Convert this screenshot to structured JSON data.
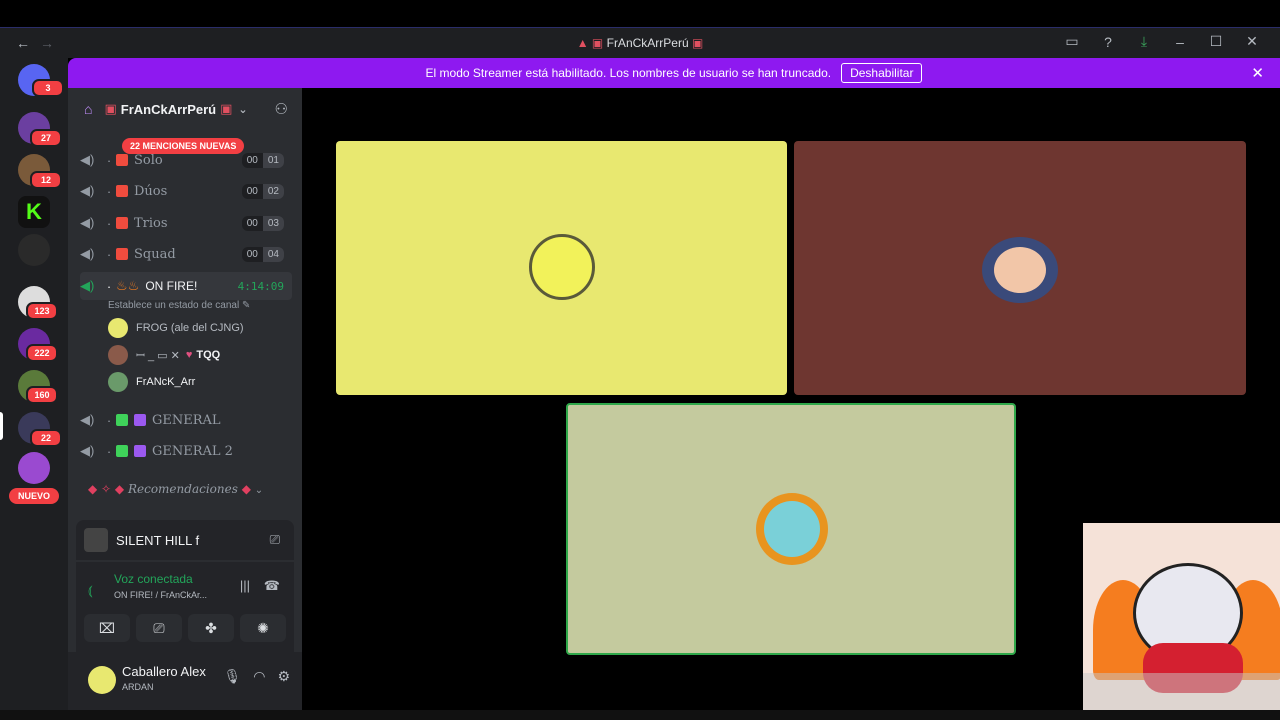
{
  "window": {
    "title": "FrAnCkArrPerú",
    "controls": [
      "inbox-icon",
      "help-icon",
      "download-icon",
      "minimize-icon",
      "maximize-icon",
      "close-icon"
    ]
  },
  "rail": {
    "servers": [
      {
        "badge": "3"
      },
      {
        "badge": "27"
      },
      {
        "badge": "12"
      },
      {
        "badge": ""
      },
      {
        "badge": ""
      },
      {
        "badge": "123"
      },
      {
        "badge": "222"
      },
      {
        "badge": "160"
      },
      {
        "badge": "22"
      },
      {
        "badge": ""
      }
    ],
    "nuevo": "NUEVO"
  },
  "banner": {
    "message": "El modo Streamer está habilitado. Los nombres de usuario se han truncado.",
    "button": "Deshabilitar"
  },
  "sidebar": {
    "server_name": "FrAnCkArrPerú",
    "mentions": "22 MENCIONES NUEVAS",
    "channels": [
      {
        "name": "Solo",
        "count_a": "00",
        "count_b": "01"
      },
      {
        "name": "Dúos",
        "count_a": "00",
        "count_b": "02"
      },
      {
        "name": "Trios",
        "count_a": "00",
        "count_b": "03"
      },
      {
        "name": "Squad",
        "count_a": "00",
        "count_b": "04"
      }
    ],
    "active_channel": {
      "name": "ON FIRE!",
      "timer": "4:14:09",
      "status": "Establece un estado de canal"
    },
    "members": [
      {
        "name": "FROG (ale del CJNG)"
      },
      {
        "name": "TQQ"
      },
      {
        "name": "FrANcK_Arr"
      }
    ],
    "channels2": [
      {
        "name": "GENERAL"
      },
      {
        "name": "GENERAL 2"
      }
    ],
    "category": "Recomendaciones"
  },
  "game": {
    "name": "SILENT HILL f"
  },
  "voice": {
    "status": "Voz conectada",
    "channel": "ON FIRE! / FrAnCkAr..."
  },
  "user": {
    "name": "Caballero Alex",
    "status": "ARDAN"
  },
  "colors": {
    "banner": "#8e19f0",
    "tile1": "#e8e870",
    "tile2": "#6e3630",
    "tile3": "#c4ca9e",
    "speaking": "#2fa84a"
  }
}
